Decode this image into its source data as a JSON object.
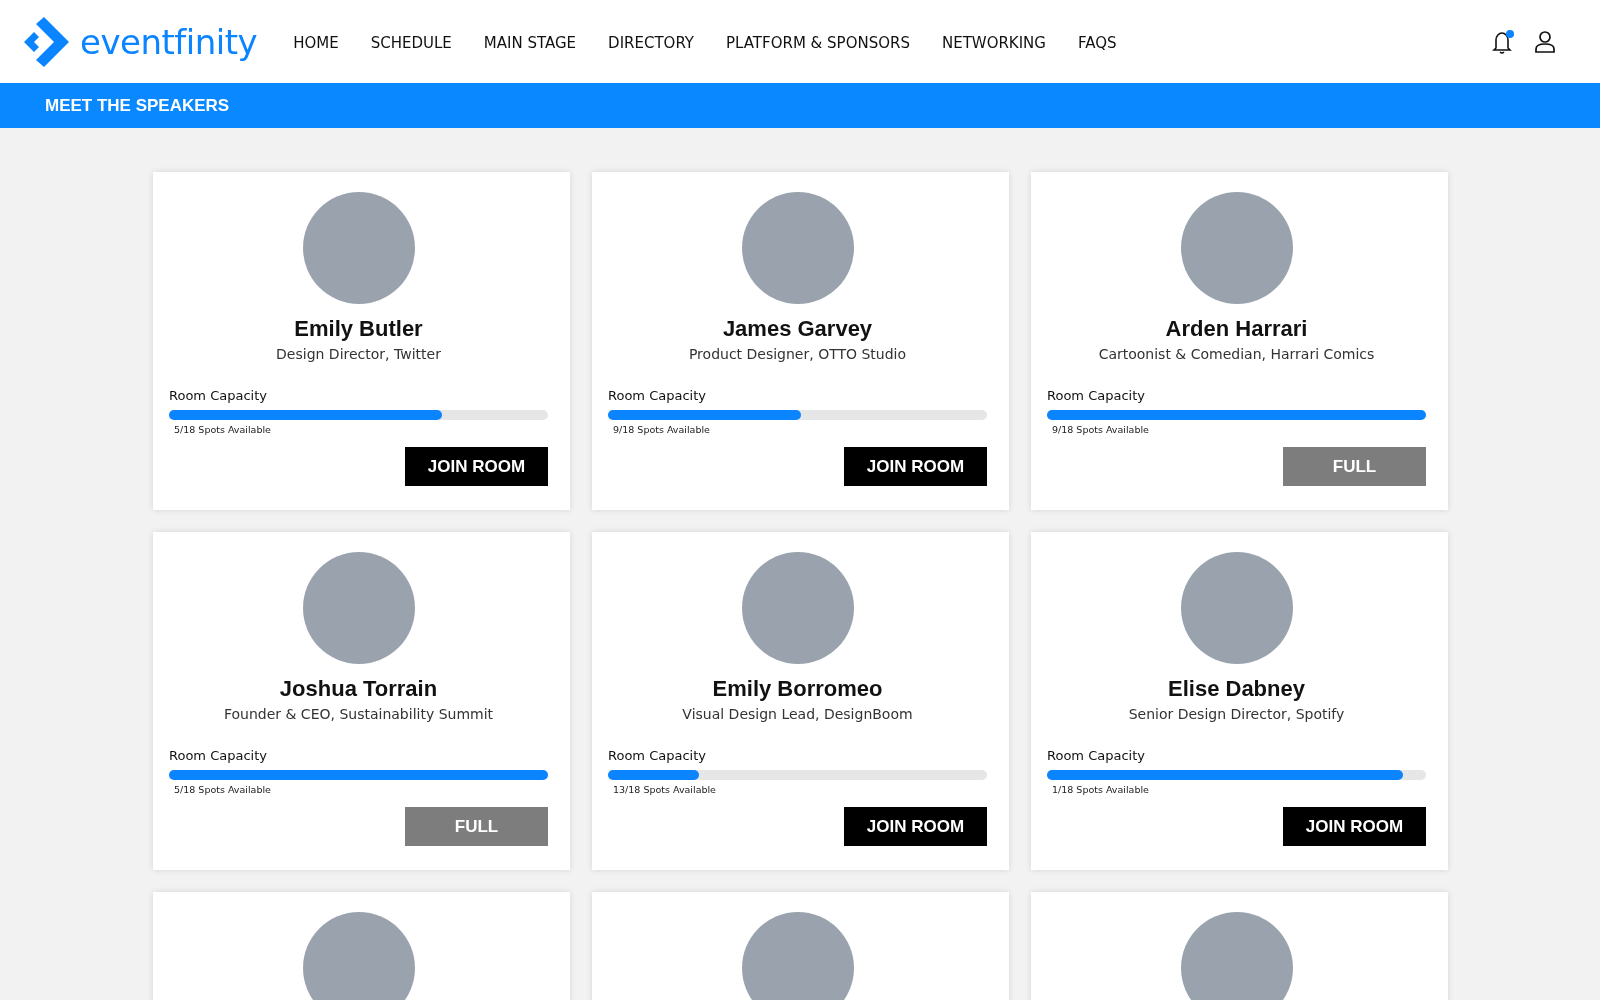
{
  "header": {
    "logo": "eventfinity",
    "nav": [
      "HOME",
      "SCHEDULE",
      "MAIN STAGE",
      "DIRECTORY",
      "PLATFORM & SPONSORS",
      "NETWORKING",
      "FAQS"
    ],
    "notification_unread": true
  },
  "banner": {
    "title": "MEET THE SPEAKERS"
  },
  "speakers": [
    {
      "name": "Emily Butler",
      "role": "Design Director, Twitter",
      "capacity_label": "Room Capacity",
      "level": 0.72,
      "spots": "5/18 Spots Available",
      "button": {
        "label": "JOIN ROOM",
        "disabled": false
      }
    },
    {
      "name": "James Garvey",
      "role": "Product Designer, OTTO Studio",
      "capacity_label": "Room Capacity",
      "level": 0.51,
      "spots": "9/18 Spots Available",
      "button": {
        "label": "JOIN ROOM",
        "disabled": false
      }
    },
    {
      "name": "Arden Harrari",
      "role": "Cartoonist & Comedian, Harrari Comics",
      "capacity_label": "Room Capacity",
      "level": 1,
      "spots": "9/18 Spots Available",
      "button": {
        "label": "FULL",
        "disabled": true
      }
    },
    {
      "name": "Joshua Torrain",
      "role": "Founder & CEO, Sustainability Summit",
      "capacity_label": "Room Capacity",
      "level": 1,
      "spots": "5/18 Spots Available",
      "button": {
        "label": "FULL",
        "disabled": true
      }
    },
    {
      "name": "Emily Borromeo",
      "role": "Visual Design Lead, DesignBoom",
      "capacity_label": "Room Capacity",
      "level": 0.24,
      "spots": "13/18 Spots Available",
      "button": {
        "label": "JOIN ROOM",
        "disabled": false
      }
    },
    {
      "name": "Elise Dabney",
      "role": "Senior Design Director, Spotify",
      "capacity_label": "Room Capacity",
      "level": 0.94,
      "spots": "1/18 Spots Available",
      "button": {
        "label": "JOIN ROOM",
        "disabled": false
      }
    }
  ]
}
